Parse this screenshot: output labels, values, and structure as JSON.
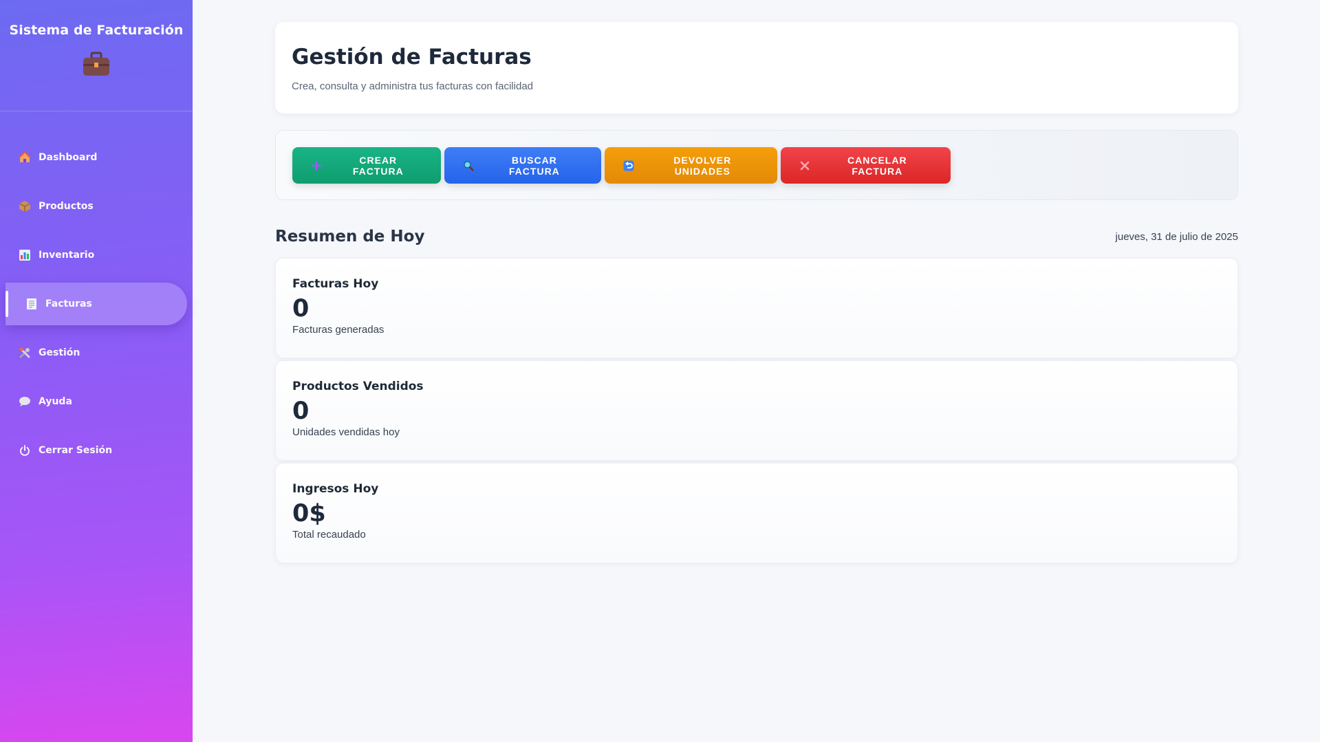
{
  "sidebar": {
    "title": "Sistema de Facturación",
    "logo_icon": "briefcase-icon",
    "items": [
      {
        "label": "Dashboard",
        "icon": "house-icon",
        "active": false
      },
      {
        "label": "Productos",
        "icon": "package-icon",
        "active": false
      },
      {
        "label": "Inventario",
        "icon": "bar-chart-icon",
        "active": false
      },
      {
        "label": "Facturas",
        "icon": "receipt-icon",
        "active": true
      },
      {
        "label": "Gestión",
        "icon": "tools-icon",
        "active": false
      },
      {
        "label": "Ayuda",
        "icon": "speech-bubble-icon",
        "active": false
      },
      {
        "label": "Cerrar Sesión",
        "icon": "power-icon",
        "active": false
      }
    ]
  },
  "header": {
    "title": "Gestión de Facturas",
    "subtitle": "Crea, consulta y administra tus facturas con facilidad"
  },
  "actions": [
    {
      "label": "CREAR FACTURA",
      "icon": "plus-icon",
      "color": "#10a877"
    },
    {
      "label": "BUSCAR FACTURA",
      "icon": "magnifier-icon",
      "color": "#2f6ff0"
    },
    {
      "label": "DEVOLVER UNIDADES",
      "icon": "return-icon",
      "color": "#ef960a"
    },
    {
      "label": "CANCELAR FACTURA",
      "icon": "cross-icon",
      "color": "#e5373b"
    }
  ],
  "summary": {
    "title": "Resumen de Hoy",
    "date": "jueves, 31 de julio de 2025",
    "stats": [
      {
        "title": "Facturas Hoy",
        "value": "0",
        "desc": "Facturas generadas"
      },
      {
        "title": "Productos Vendidos",
        "value": "0",
        "desc": "Unidades vendidas hoy"
      },
      {
        "title": "Ingresos Hoy",
        "value": "0$",
        "desc": "Total recaudado"
      }
    ]
  },
  "colors": {
    "sidebar_gradient_top": "#6d6af2",
    "sidebar_gradient_bottom": "#d946ef",
    "background": "#f6f7fb"
  }
}
